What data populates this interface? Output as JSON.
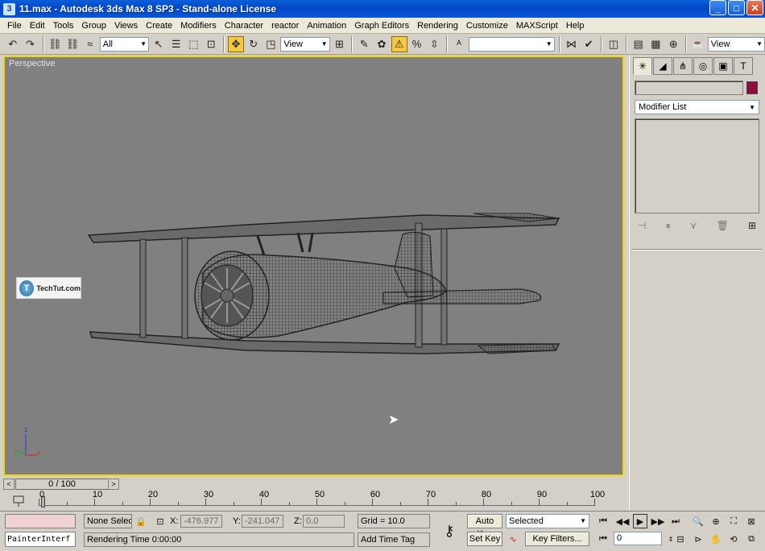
{
  "window": {
    "title": "11.max - Autodesk 3ds Max 8 SP3  - Stand-alone License",
    "minimize": "_",
    "maximize": "□",
    "close": "✕"
  },
  "menu": [
    "File",
    "Edit",
    "Tools",
    "Group",
    "Views",
    "Create",
    "Modifiers",
    "Character",
    "reactor",
    "Animation",
    "Graph Editors",
    "Rendering",
    "Customize",
    "MAXScript",
    "Help"
  ],
  "toolbar": {
    "selection_filter": "All",
    "ref_coord": "View",
    "named_selection": "",
    "right_view": "View"
  },
  "viewport": {
    "label": "Perspective",
    "watermark_logo": "T",
    "watermark_text": "TechTut.com",
    "axis_z": "z",
    "axis_x": "x",
    "axis_y": "y"
  },
  "command_panel": {
    "object_name": "",
    "object_color": "#8b0f3a",
    "modifier_list": "Modifier List"
  },
  "time_slider": {
    "label": "0 / 100",
    "prev": "<",
    "next": ">"
  },
  "trackbar": {
    "ticks": [
      "0",
      "10",
      "20",
      "30",
      "40",
      "50",
      "60",
      "70",
      "80",
      "90",
      "100"
    ]
  },
  "status": {
    "selection": "None Selec",
    "x_label": "X:",
    "x_value": "-476.977",
    "y_label": "Y:",
    "y_value": "-241.047",
    "z_label": "Z:",
    "z_value": "0.0",
    "grid": "Grid = 10.0",
    "rendering_time": "Rendering Time  0:00:00",
    "add_time_tag": "Add Time Tag",
    "auto_key": "Auto Key",
    "set_key": "Set Key",
    "key_mode": "Selected",
    "key_filters": "Key Filters...",
    "current_frame": "0",
    "maxscript_line": "PainterInterf"
  }
}
